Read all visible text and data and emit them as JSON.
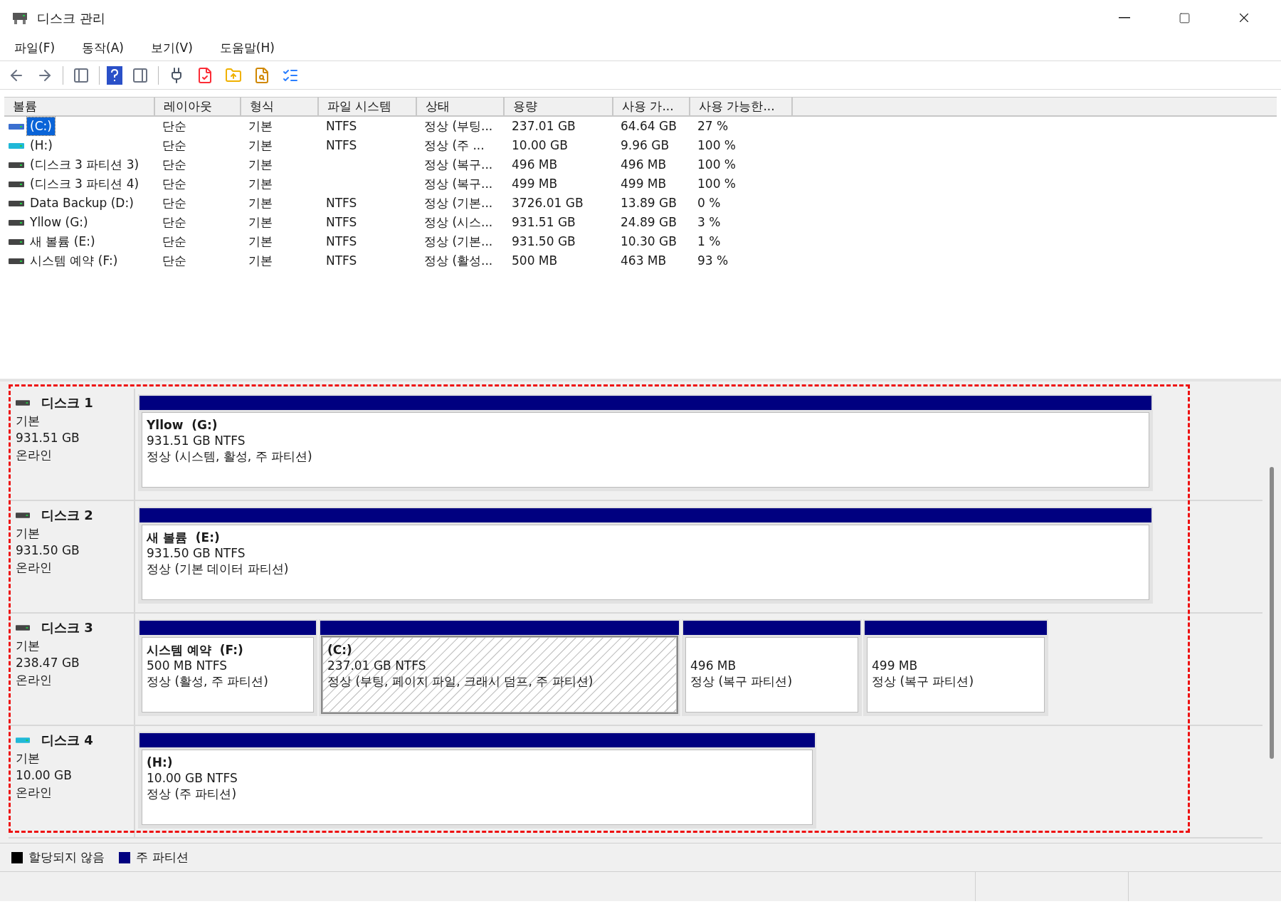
{
  "window": {
    "title": "디스크 관리"
  },
  "menu": [
    "파일(F)",
    "동작(A)",
    "보기(V)",
    "도움말(H)"
  ],
  "table": {
    "columns": [
      "볼륨",
      "레이아웃",
      "형식",
      "파일 시스템",
      "상태",
      "용량",
      "사용 가...",
      "사용 가능한..."
    ],
    "rows": [
      {
        "kind": "selected-volume",
        "selected": true,
        "cells": [
          "(C:)",
          "단순",
          "기본",
          "NTFS",
          "정상 (부팅...",
          "237.01 GB",
          "64.64 GB",
          "27 %"
        ]
      },
      {
        "kind": "removable",
        "selected": false,
        "cells": [
          "(H:)",
          "단순",
          "기본",
          "NTFS",
          "정상 (주 ...",
          "10.00 GB",
          "9.96 GB",
          "100 %"
        ]
      },
      {
        "kind": "fixed",
        "selected": false,
        "cells": [
          "(디스크 3 파티션 3)",
          "단순",
          "기본",
          "",
          "정상 (복구...",
          "496 MB",
          "496 MB",
          "100 %"
        ]
      },
      {
        "kind": "fixed",
        "selected": false,
        "cells": [
          "(디스크 3 파티션 4)",
          "단순",
          "기본",
          "",
          "정상 (복구...",
          "499 MB",
          "499 MB",
          "100 %"
        ]
      },
      {
        "kind": "fixed",
        "selected": false,
        "cells": [
          "Data Backup (D:)",
          "단순",
          "기본",
          "NTFS",
          "정상 (기본...",
          "3726.01 GB",
          "13.89 GB",
          "0 %"
        ]
      },
      {
        "kind": "fixed",
        "selected": false,
        "cells": [
          "Yllow (G:)",
          "단순",
          "기본",
          "NTFS",
          "정상 (시스...",
          "931.51 GB",
          "24.89 GB",
          "3 %"
        ]
      },
      {
        "kind": "fixed",
        "selected": false,
        "cells": [
          "새 볼륨 (E:)",
          "단순",
          "기본",
          "NTFS",
          "정상 (기본...",
          "931.50 GB",
          "10.30 GB",
          "1 %"
        ]
      },
      {
        "kind": "fixed",
        "selected": false,
        "cells": [
          "시스템 예약 (F:)",
          "단순",
          "기본",
          "NTFS",
          "정상 (활성...",
          "500 MB",
          "463 MB",
          "93 %"
        ]
      }
    ]
  },
  "disks": [
    {
      "name": "디스크 1",
      "kind": "fixed",
      "type": "기본",
      "size": "931.51 GB",
      "status": "온라인",
      "partitions": [
        {
          "name": "Yllow  (G:)",
          "size": "931.51 GB NTFS",
          "status": "정상 (시스템, 활성, 주 파티션)",
          "selected": false
        }
      ]
    },
    {
      "name": "디스크 2",
      "kind": "fixed",
      "type": "기본",
      "size": "931.50 GB",
      "status": "온라인",
      "partitions": [
        {
          "name": "새 볼륨  (E:)",
          "size": "931.50 GB NTFS",
          "status": "정상 (기본 데이터 파티션)",
          "selected": false
        }
      ]
    },
    {
      "name": "디스크 3",
      "kind": "fixed",
      "type": "기본",
      "size": "238.47 GB",
      "status": "온라인",
      "partitions": [
        {
          "name": "시스템 예약  (F:)",
          "size": "500 MB NTFS",
          "status": "정상 (활성, 주 파티션)",
          "selected": false
        },
        {
          "name": "(C:)",
          "size": "237.01 GB NTFS",
          "status": "정상 (부팅, 페이지 파일, 크래시 덤프, 주 파티션)",
          "selected": true
        },
        {
          "size": "496 MB",
          "status": "정상 (복구 파티션)",
          "selected": false
        },
        {
          "size": "499 MB",
          "status": "정상 (복구 파티션)",
          "selected": false
        }
      ]
    },
    {
      "name": "디스크 4",
      "kind": "removable",
      "type": "기본",
      "size": "10.00 GB",
      "status": "온라인",
      "partitions": [
        {
          "name": "(H:)",
          "size": "10.00 GB NTFS",
          "status": "정상 (주 파티션)",
          "selected": false
        }
      ]
    }
  ],
  "legend": [
    {
      "label": "할당되지 않음",
      "color": "#000000"
    },
    {
      "label": "주 파티션",
      "color": "#000080"
    }
  ]
}
